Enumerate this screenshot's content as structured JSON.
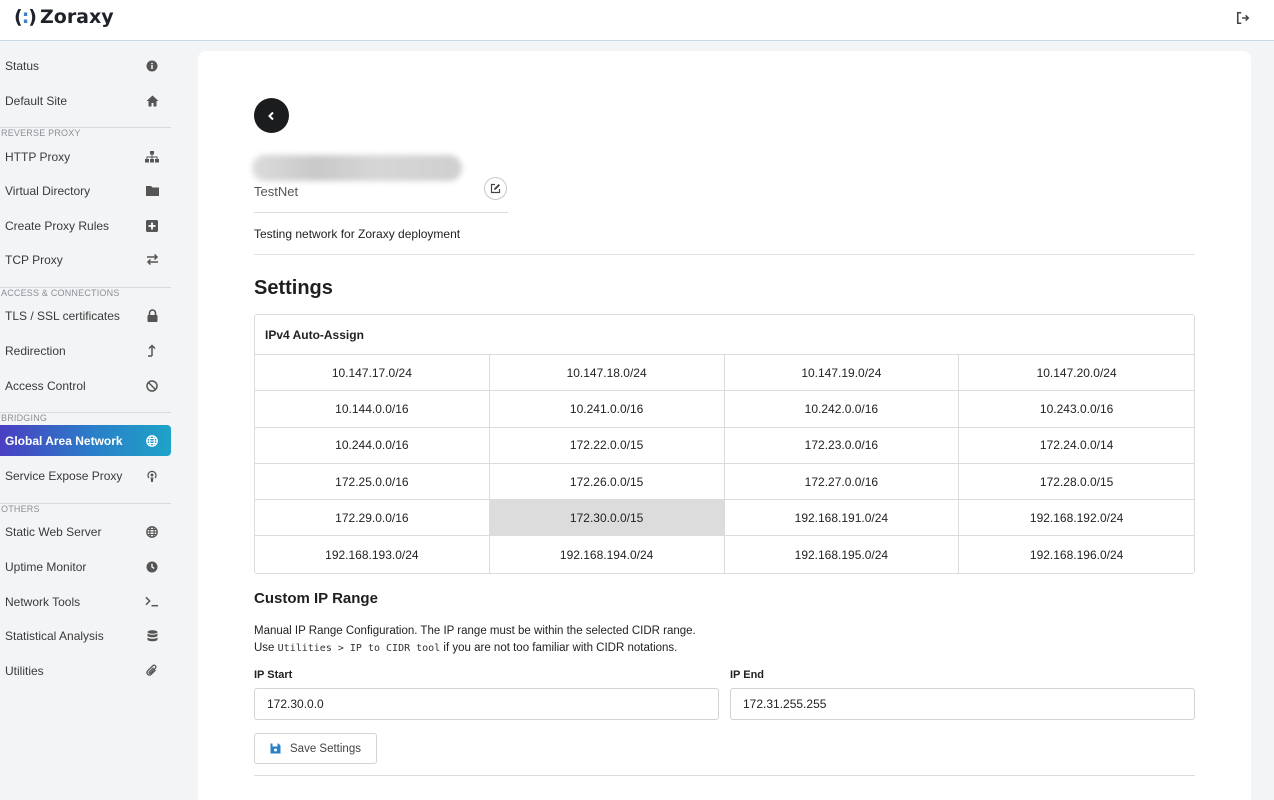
{
  "app": {
    "logo_mark": "(:)",
    "name": "Zoraxy"
  },
  "header": {
    "logout_icon": "sign-out-icon"
  },
  "sidebar": {
    "items": [
      {
        "label": "Status",
        "icon": "info-circle-icon"
      },
      {
        "label": "Default Site",
        "icon": "home-icon"
      },
      {
        "label": "HTTP Proxy",
        "icon": "sitemap-icon"
      },
      {
        "label": "Virtual Directory",
        "icon": "folder-icon"
      },
      {
        "label": "Create Proxy Rules",
        "icon": "plus-square-icon"
      },
      {
        "label": "TCP Proxy",
        "icon": "exchange-icon"
      },
      {
        "label": "TLS / SSL certificates",
        "icon": "lock-icon"
      },
      {
        "label": "Redirection",
        "icon": "level-up-icon"
      },
      {
        "label": "Access Control",
        "icon": "ban-icon"
      },
      {
        "label": "Global Area Network",
        "icon": "globe-icon",
        "active": true
      },
      {
        "label": "Service Expose Proxy",
        "icon": "podcast-icon"
      },
      {
        "label": "Static Web Server",
        "icon": "globe-icon"
      },
      {
        "label": "Uptime Monitor",
        "icon": "clock-icon"
      },
      {
        "label": "Network Tools",
        "icon": "terminal-icon"
      },
      {
        "label": "Statistical Analysis",
        "icon": "database-icon"
      },
      {
        "label": "Utilities",
        "icon": "paperclip-icon"
      }
    ],
    "sections": {
      "reverse_proxy": "REVERSE PROXY",
      "access": "ACCESS & CONNECTIONS",
      "bridging": "BRIDGING",
      "others": "OTHERS"
    }
  },
  "network": {
    "name": "TestNet",
    "description": "Testing network for Zoraxy deployment"
  },
  "settings": {
    "title": "Settings",
    "auto_assign_title": "IPv4 Auto-Assign",
    "cidrs": [
      "10.147.17.0/24",
      "10.147.18.0/24",
      "10.147.19.0/24",
      "10.147.20.0/24",
      "10.144.0.0/16",
      "10.241.0.0/16",
      "10.242.0.0/16",
      "10.243.0.0/16",
      "10.244.0.0/16",
      "172.22.0.0/15",
      "172.23.0.0/16",
      "172.24.0.0/14",
      "172.25.0.0/16",
      "172.26.0.0/15",
      "172.27.0.0/16",
      "172.28.0.0/15",
      "172.29.0.0/16",
      "172.30.0.0/15",
      "192.168.191.0/24",
      "192.168.192.0/24",
      "192.168.193.0/24",
      "192.168.194.0/24",
      "192.168.195.0/24",
      "192.168.196.0/24"
    ],
    "selected_cidr": "172.30.0.0/15"
  },
  "custom_range": {
    "title": "Custom IP Range",
    "desc_line1": "Manual IP Range Configuration. The IP range must be within the selected CIDR range.",
    "desc_use": "Use",
    "desc_tool": "Utilities > IP to CIDR tool",
    "desc_rest": "if you are not too familiar with CIDR notations.",
    "ip_start_label": "IP Start",
    "ip_start_value": "172.30.0.0",
    "ip_end_label": "IP End",
    "ip_end_value": "172.31.255.255",
    "save_label": "Save Settings"
  }
}
